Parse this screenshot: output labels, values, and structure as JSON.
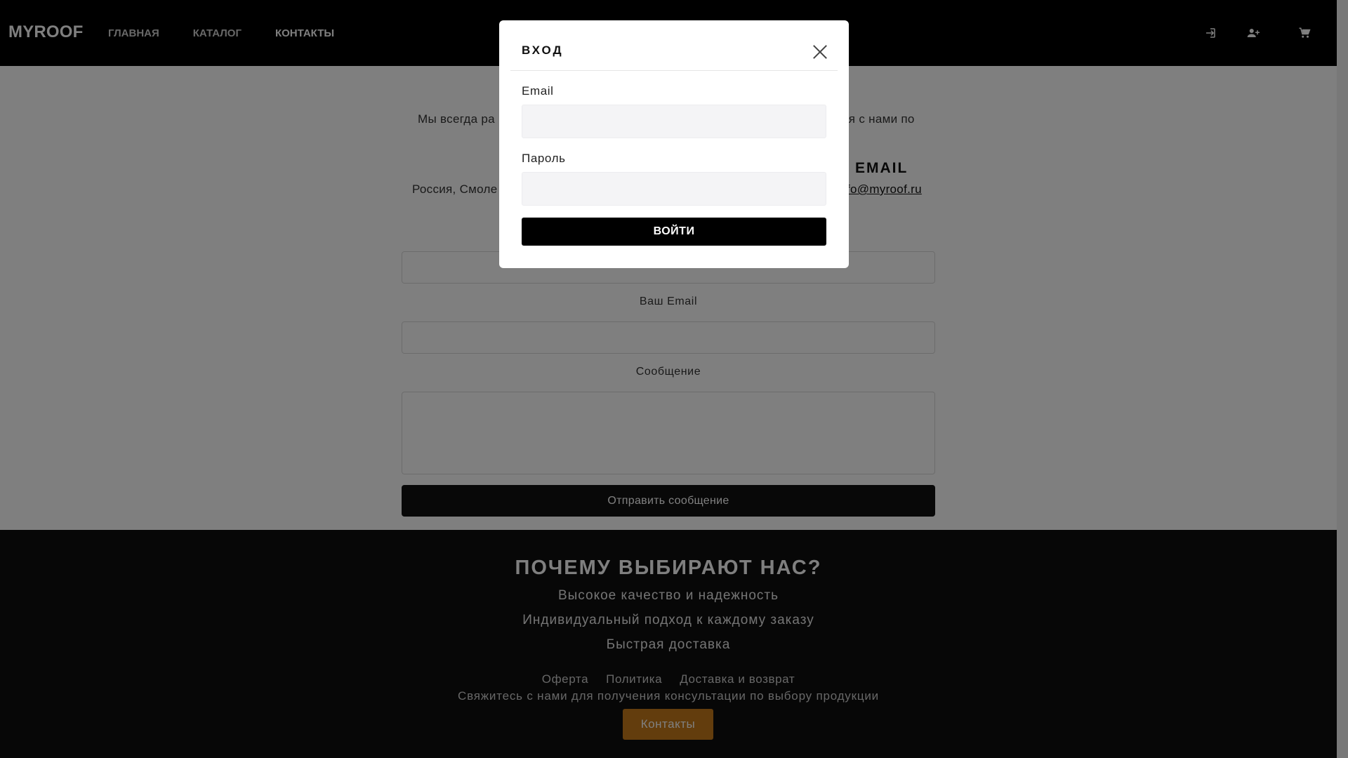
{
  "header": {
    "logo": "MYROOF",
    "nav": [
      {
        "label": "ГЛАВНАЯ"
      },
      {
        "label": "КАТАЛОГ"
      },
      {
        "label": "КОНТАКТЫ",
        "active": true
      }
    ],
    "icons": [
      "login-icon",
      "add-user-icon",
      "cart-icon"
    ]
  },
  "main": {
    "intro_left": "Мы всегда ра",
    "intro_right": "ся с нами по",
    "email_heading": "EMAIL",
    "address_fragment": "Россия, Смоле",
    "email_link": "fo@myroof.ru",
    "form": {
      "email_label": "Ваш Email",
      "message_label": "Сообщение",
      "send_label": "Отправить сообщение"
    }
  },
  "footer": {
    "title": "ПОЧЕМУ ВЫБИРАЮТ НАС?",
    "benefits": [
      "Высокое качество и надежность",
      "Индивидуальный подход к каждому заказу",
      "Быстрая доставка"
    ],
    "links": [
      "Оферта",
      "Политика",
      "Доставка и возврат"
    ],
    "consult_text": "Свяжитесь с нами для получения консультации по выбору продукции",
    "contacts_button": "Контакты",
    "accent_color": "#c77a1a"
  },
  "modal": {
    "title": "ВХОД",
    "email_label": "Email",
    "email_value": "",
    "password_label": "Пароль",
    "password_value": "",
    "submit_label": "ВОЙТИ"
  }
}
